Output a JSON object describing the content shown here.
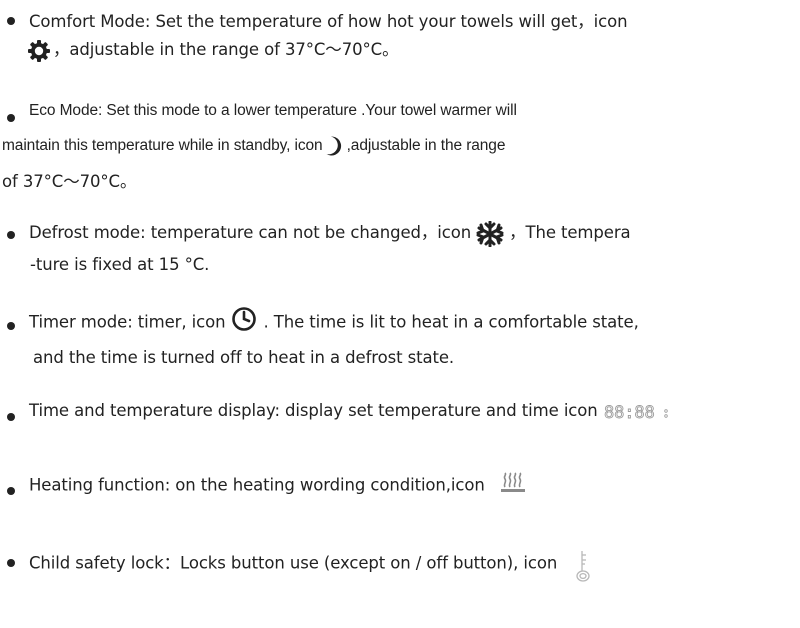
{
  "items": [
    {
      "id": "comfort",
      "line1": "Comfort Mode: Set the temperature of how hot your towels will get，icon",
      "line2_after_icon": "，adjustable in the range of 37°C～70°C。",
      "icon": "sun-gear-icon"
    },
    {
      "id": "eco",
      "line1": "Eco Mode: Set this mode to a lower temperature .Your towel warmer will",
      "line2_before_icon": "maintain this temperature while in standby, icon",
      "line2_after_icon": ",adjustable in the range",
      "line3": "of 37°C～70°C。",
      "icon": "moon-icon"
    },
    {
      "id": "defrost",
      "line1_before_icon": "Defrost mode: temperature can not be changed，icon",
      "line1_after_icon": "，The tempera",
      "line2": "-ture is fixed at 15 °C.",
      "icon": "snowflake-icon"
    },
    {
      "id": "timer",
      "line1_before_icon": "Timer mode: timer, icon",
      "line1_after_icon": ". The time is lit to heat in a comfortable state,",
      "line2": "and the time is turned off to heat in a defrost state.",
      "icon": "clock-icon"
    },
    {
      "id": "display",
      "line1_before_icon": "Time and temperature display: display set temperature and time icon",
      "icon": "segment-display-icon",
      "display_text": "88:88"
    },
    {
      "id": "heating",
      "line1_before_icon": "Heating function: on the heating wording condition,icon",
      "icon": "heating-icon"
    },
    {
      "id": "lock",
      "line1_before_icon": "Child safety lock：Locks button use (except on / off button), icon",
      "icon": "key-icon"
    }
  ],
  "colors": {
    "text": "#222222",
    "icon": "#222222",
    "icon_light": "#b8b8b8"
  }
}
